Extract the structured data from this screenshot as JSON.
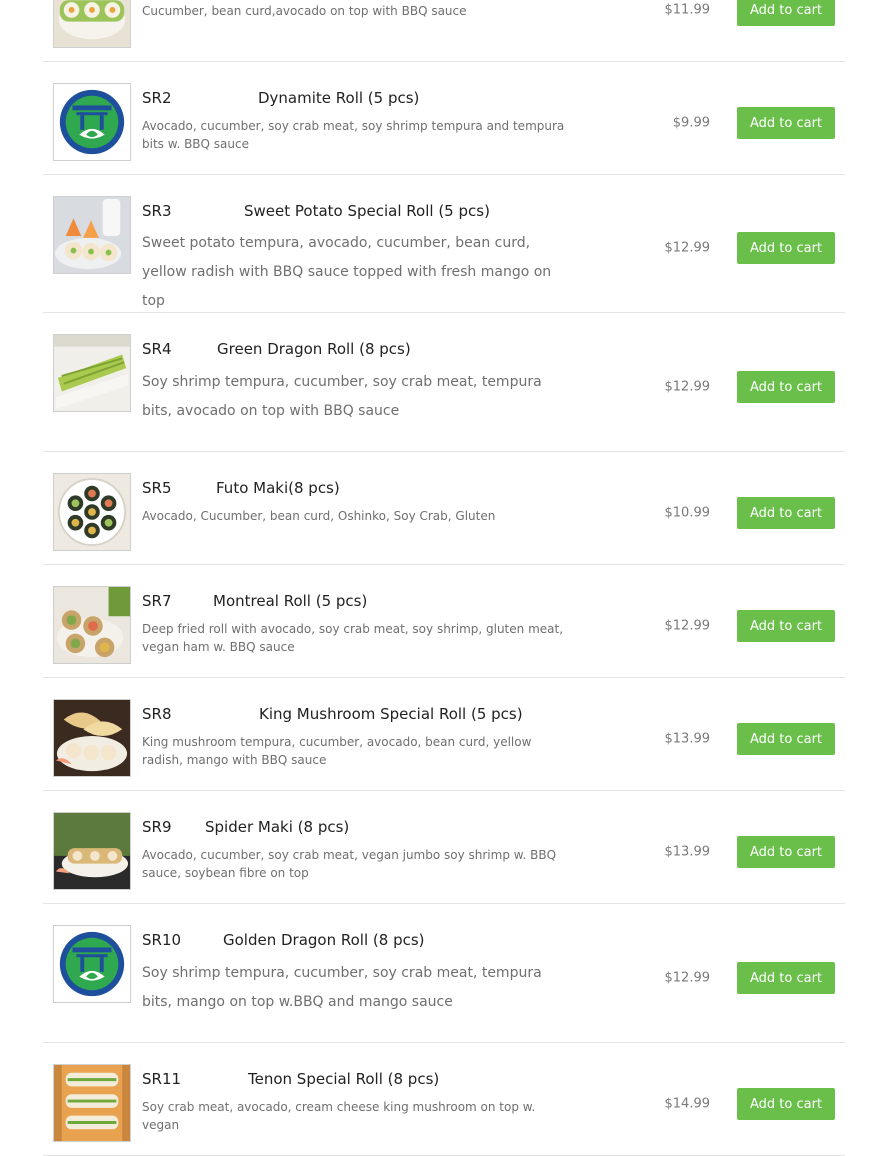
{
  "colors": {
    "button": "#6abf4b",
    "button_text": "#ffffff",
    "price": "#7a7a7a",
    "description": "#6f6f6f"
  },
  "items": [
    {
      "code": "",
      "name": "",
      "description": "Cucumber, bean curd,avocado on top with BBQ sauce",
      "price": "$11.99",
      "cart_label": "Add to cart",
      "image": "sushi-photo"
    },
    {
      "code": "SR2",
      "name": "Dynamite Roll (5 pcs)",
      "description": "Avocado, cucumber, soy crab meat, soy shrimp tempura and tempura bits w. BBQ sauce",
      "price": "$9.99",
      "cart_label": "Add to cart",
      "image": "restaurant-logo"
    },
    {
      "code": "SR3",
      "name": "Sweet Potato Special Roll (5 pcs)",
      "description": "Sweet potato tempura, avocado, cucumber, bean curd, yellow radish with BBQ sauce topped with fresh mango on top",
      "price": "$12.99",
      "cart_label": "Add to cart",
      "image": "sushi-photo"
    },
    {
      "code": "SR4",
      "name": "Green Dragon Roll (8 pcs)",
      "description": "Soy shrimp tempura, cucumber, soy crab meat, tempura bits, avocado on top with BBQ sauce",
      "price": "$12.99",
      "cart_label": "Add to cart",
      "image": "sushi-photo"
    },
    {
      "code": "SR5",
      "name": "Futo Maki(8 pcs)",
      "description": "Avocado, Cucumber, bean curd, Oshinko, Soy Crab, Gluten",
      "price": "$10.99",
      "cart_label": "Add to cart",
      "image": "sushi-photo"
    },
    {
      "code": "SR7",
      "name": "Montreal Roll (5 pcs)",
      "description": "Deep fried roll with avocado, soy crab meat, soy shrimp, gluten meat, vegan ham w. BBQ sauce",
      "price": "$12.99",
      "cart_label": "Add to cart",
      "image": "sushi-photo"
    },
    {
      "code": "SR8",
      "name": "King Mushroom Special Roll (5 pcs)",
      "description": "King mushroom tempura, cucumber, avocado, bean curd, yellow radish, mango with BBQ sauce",
      "price": "$13.99",
      "cart_label": "Add to cart",
      "image": "sushi-photo"
    },
    {
      "code": "SR9",
      "name": "Spider Maki (8 pcs)",
      "description": "Avocado, cucumber, soy crab meat, vegan jumbo soy shrimp w. BBQ sauce, soybean fibre on top",
      "price": "$13.99",
      "cart_label": "Add to cart",
      "image": "sushi-photo"
    },
    {
      "code": "SR10",
      "name": "Golden Dragon Roll (8 pcs)",
      "description": "Soy shrimp tempura, cucumber, soy crab meat, tempura bits, mango on top w.BBQ and mango sauce",
      "price": "$12.99",
      "cart_label": "Add to cart",
      "image": "restaurant-logo"
    },
    {
      "code": "SR11",
      "name": "Tenon Special Roll (8 pcs)",
      "description": "Soy crab meat, avocado, cream cheese king mushroom on top w. vegan",
      "price": "$14.99",
      "cart_label": "Add to cart",
      "image": "sushi-photo"
    }
  ]
}
